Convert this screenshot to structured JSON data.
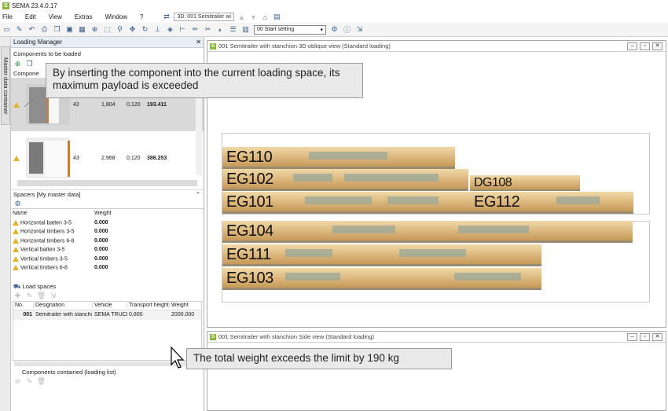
{
  "app": {
    "title": "SEMA  23.4.0.17"
  },
  "menu": [
    "File",
    "Edit",
    "View",
    "Extras",
    "Window",
    "?"
  ],
  "doc_tab": "3D: 001 Semitrailer wi",
  "toolbar": {
    "view_setting": "00 Start setting"
  },
  "side_tab": "Master data container",
  "loading_manager": {
    "title": "Loading Manager",
    "components_title": "Components to be loaded",
    "header_partial": "Compone",
    "rows": [
      {
        "no": "42",
        "length": "1,804",
        "thick": "0,120",
        "weight": "193.411"
      },
      {
        "no": "43",
        "length": "2,968",
        "thick": "0,120",
        "weight": "386.253"
      }
    ]
  },
  "spacers": {
    "title": "Spacers [My master data]",
    "columns": [
      "Name",
      "Weight"
    ],
    "items": [
      {
        "name": "Horizontal batten 3-5",
        "weight": "0.000"
      },
      {
        "name": "Horizontal timbers 3-5",
        "weight": "0.000"
      },
      {
        "name": "Horizontal timbers 6-8",
        "weight": "0.000"
      },
      {
        "name": "Vertical batten 3-5",
        "weight": "0.000"
      },
      {
        "name": "Vertical timbers 3-5",
        "weight": "0.000"
      },
      {
        "name": "Vertical timbers 6-8",
        "weight": "0.000"
      }
    ]
  },
  "load_spaces": {
    "title": "Load spaces",
    "columns": [
      "No.",
      "Designation",
      "Vehicle",
      "Transport height",
      "Weight"
    ],
    "rows": [
      {
        "no": "001",
        "designation": "Semitrailer with stanchi",
        "vehicle": "SEMA TRUCK",
        "height": "0,800",
        "weight": "2000.000"
      }
    ]
  },
  "contained_title": "Components contained (loading list)",
  "view3d": {
    "title": "001 Semitrailer with stanchion 3D oblique view (Standard loading)",
    "bundles": [
      "EG110",
      "EG102",
      "DG108",
      "EG101",
      "EG112",
      "EG104",
      "EG111",
      "EG103"
    ]
  },
  "side_view": {
    "title": "001 Semitrailer with stanchion Side view (Standard loading)"
  },
  "callouts": {
    "payload": "By inserting the component into the current loading space, its maximum payload is exceeded",
    "weight": "The total weight exceeds the limit by 190 kg"
  },
  "colors": {
    "accent": "#8cb83a",
    "warning": "#e3b12a",
    "wood": "#d9b277"
  }
}
